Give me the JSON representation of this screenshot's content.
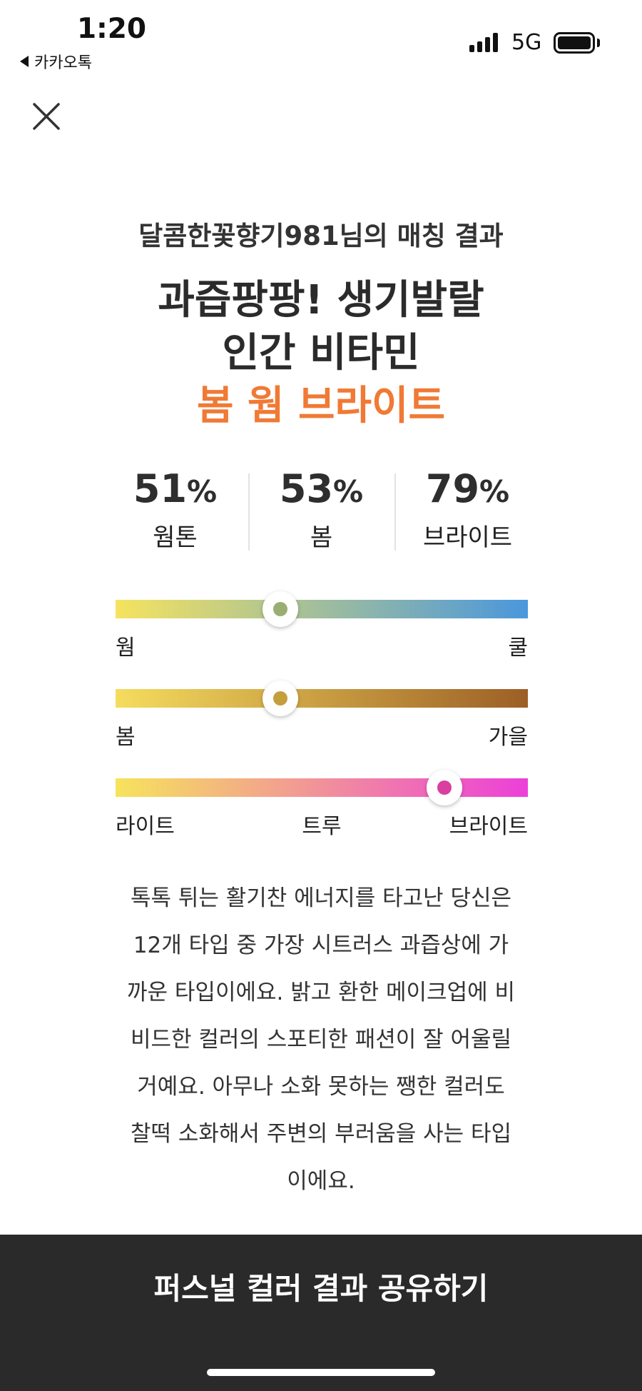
{
  "status_bar": {
    "time": "1:20",
    "back_app": "카카오톡",
    "network": "5G"
  },
  "header": {
    "subtitle": "달콤한꽃향기981님의 매칭 결과",
    "title_line1": "과즙팡팡! 생기발랄",
    "title_line2": "인간 비타민",
    "title_accent": "봄 웜 브라이트",
    "accent_color": "#f07a35"
  },
  "stats": [
    {
      "value": "51",
      "unit": "%",
      "label": "웜톤"
    },
    {
      "value": "53",
      "unit": "%",
      "label": "봄"
    },
    {
      "value": "79",
      "unit": "%",
      "label": "브라이트"
    }
  ],
  "sliders": [
    {
      "left_label": "웜",
      "right_label": "쿨",
      "position": 0.4,
      "gradient": [
        "#f5e35f",
        "#4a97dc"
      ],
      "dot_color": "#9aae74"
    },
    {
      "left_label": "봄",
      "right_label": "가을",
      "position": 0.4,
      "gradient": [
        "#f5dc5e",
        "#9c5f26"
      ],
      "dot_color": "#c49f3c"
    },
    {
      "left_label": "라이트",
      "middle_label": "트루",
      "right_label": "브라이트",
      "position": 0.797,
      "gradient": [
        "#f6e35c",
        "#ec3fd9"
      ],
      "dot_color": "#d83f9e"
    }
  ],
  "description": "톡톡 튀는 활기찬 에너지를 타고난 당신은 12개 타입 중 가장 시트러스 과즙상에 가까운 타입이에요. 밝고 환한 메이크업에 비비드한 컬러의 스포티한 패션이 잘 어울릴 거예요. 아무나 소화 못하는 쨍한 컬러도 찰떡 소화해서 주변의 부러움을 사는 타입이에요.",
  "share_button": "퍼스널 컬러 결과 공유하기",
  "icons": {
    "close": "close-icon",
    "back": "back-triangle-icon",
    "signal": "signal-icon",
    "battery": "battery-icon"
  }
}
